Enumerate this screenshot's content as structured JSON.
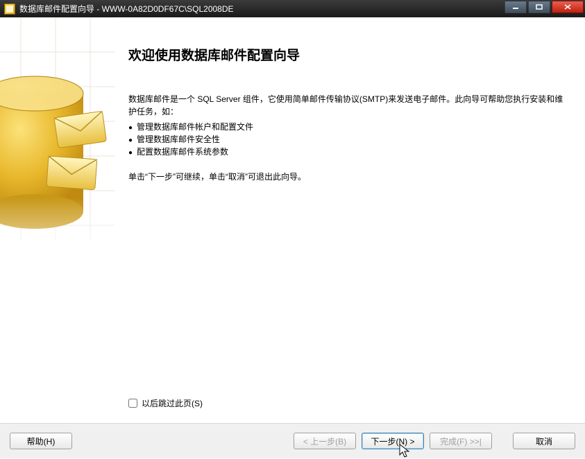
{
  "titlebar": {
    "title": "数据库邮件配置向导 - WWW-0A82D0DF67C\\SQL2008DE"
  },
  "wizard": {
    "heading": "欢迎使用数据库邮件配置向导",
    "intro": "数据库邮件是一个 SQL Server 组件，它使用简单邮件传输协议(SMTP)来发送电子邮件。此向导可帮助您执行安装和维护任务，如：",
    "bullets": [
      "管理数据库邮件帐户和配置文件",
      "管理数据库邮件安全性",
      "配置数据库邮件系统参数"
    ],
    "instruction": "单击“下一步”可继续，单击“取消”可退出此向导。",
    "skip_label": "以后跳过此页(S)"
  },
  "buttons": {
    "help": "帮助(H)",
    "back": "< 上一步(B)",
    "next": "下一步(N) >",
    "finish": "完成(F) >>|",
    "cancel": "取消"
  }
}
